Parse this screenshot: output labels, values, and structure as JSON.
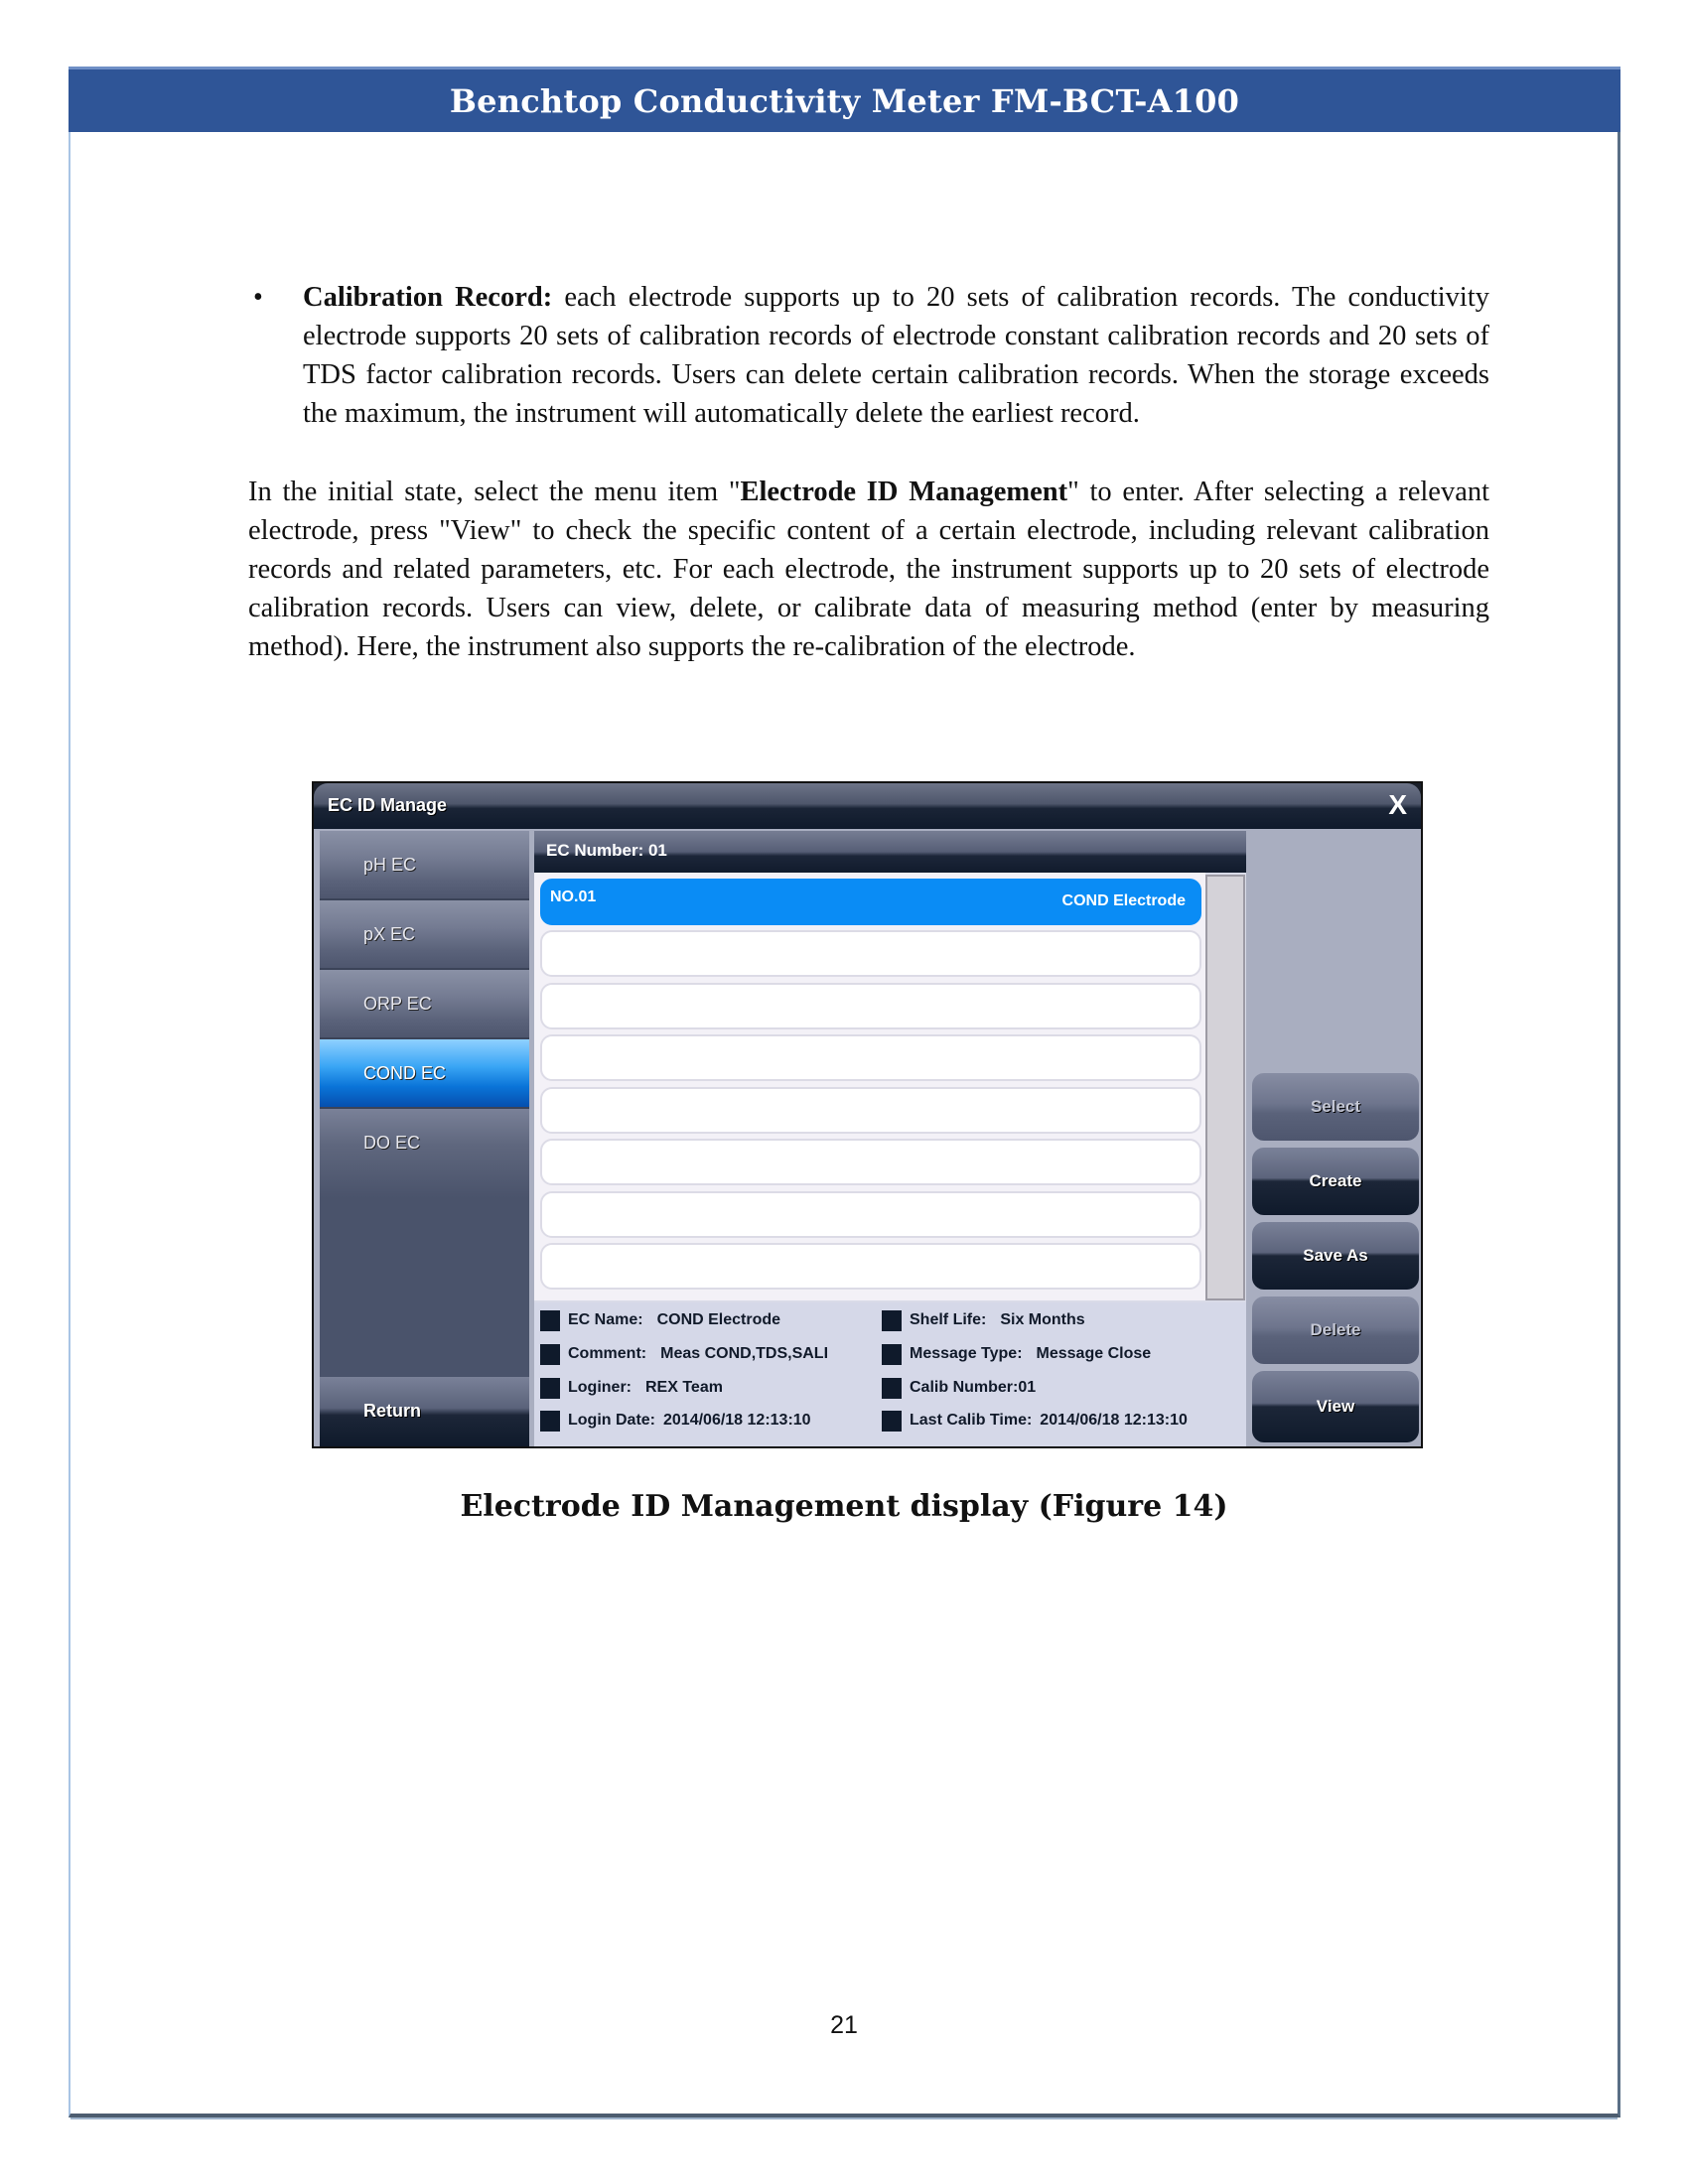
{
  "header": {
    "title": "Benchtop Conductivity Meter FM-BCT-A100"
  },
  "bullet": {
    "symbol": "•",
    "term": "Calibration Record:",
    "text": " each electrode supports up to 20 sets of calibration records. The conductivity electrode supports 20 sets of calibration records of electrode constant calibration records and 20 sets of TDS factor calibration records. Users can delete certain calibration records. When the storage exceeds the maximum, the instrument will automatically delete the earliest record."
  },
  "paragraph": {
    "before": "In the initial state, select the menu item \"",
    "emphasis": "Electrode ID Management",
    "after": "\" to enter. After selecting a relevant electrode, press \"View\" to check the specific content of a certain electrode, including relevant calibration records and related parameters, etc. For each electrode, the instrument supports up to 20 sets of electrode calibration records. Users can view, delete, or calibrate data of measuring method (enter by measuring method). Here, the instrument also supports the re-calibration of the electrode."
  },
  "ui": {
    "window_title": "EC ID Manage",
    "close_label": "X",
    "sidebar": {
      "items": [
        {
          "label": "pH EC",
          "active": false
        },
        {
          "label": "pX EC",
          "active": false
        },
        {
          "label": "ORP EC",
          "active": false
        },
        {
          "label": "COND EC",
          "active": true
        },
        {
          "label": "DO EC",
          "active": false
        }
      ],
      "return_label": "Return"
    },
    "main": {
      "header": "EC Number:  01",
      "rows": [
        {
          "no": "NO.01",
          "name": "COND Electrode",
          "selected": true
        },
        {
          "no": "",
          "name": "",
          "selected": false
        },
        {
          "no": "",
          "name": "",
          "selected": false
        },
        {
          "no": "",
          "name": "",
          "selected": false
        },
        {
          "no": "",
          "name": "",
          "selected": false
        },
        {
          "no": "",
          "name": "",
          "selected": false
        },
        {
          "no": "",
          "name": "",
          "selected": false
        },
        {
          "no": "",
          "name": "",
          "selected": false
        }
      ],
      "info": {
        "ec_name": {
          "label": "EC Name:",
          "value": "COND Electrode"
        },
        "comment": {
          "label": "Comment:",
          "value": "Meas COND,TDS,SALI"
        },
        "loginer": {
          "label": "Loginer:",
          "value": "REX Team"
        },
        "login_date": {
          "label": "Login Date:",
          "value": "2014/06/18 12:13:10"
        },
        "shelf_life": {
          "label": "Shelf Life:",
          "value": "Six Months"
        },
        "message_type": {
          "label": "Message Type:",
          "value": "Message Close"
        },
        "calib_number": {
          "label": "Calib Number:",
          "value": "01"
        },
        "last_calib_time": {
          "label": "Last Calib Time:",
          "value": "2014/06/18 12:13:10"
        }
      }
    },
    "buttons": {
      "select": {
        "label": "Select",
        "enabled": false
      },
      "create": {
        "label": "Create",
        "enabled": true
      },
      "save_as": {
        "label": "Save As",
        "enabled": true
      },
      "delete": {
        "label": "Delete",
        "enabled": false
      },
      "view": {
        "label": "View",
        "enabled": true
      }
    }
  },
  "caption": "Electrode ID Management display (Figure 14)",
  "page_number": "21"
}
